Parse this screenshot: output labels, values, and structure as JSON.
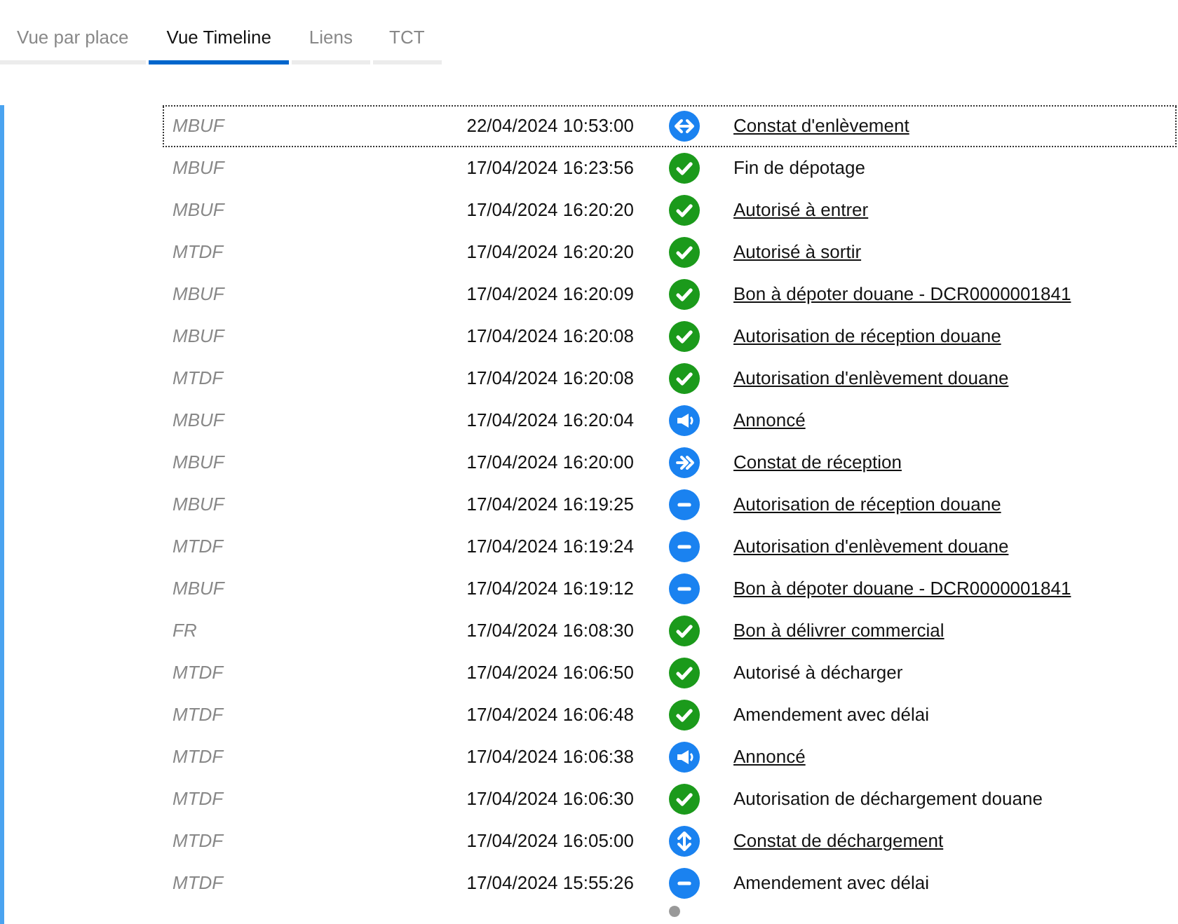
{
  "tabs": [
    {
      "label": "Vue par place",
      "selected": false
    },
    {
      "label": "Vue Timeline",
      "selected": true
    },
    {
      "label": "Liens",
      "selected": false
    },
    {
      "label": "TCT",
      "selected": false
    }
  ],
  "events": [
    {
      "source": "MBUF",
      "date": "22/04/2024 10:53:00",
      "kind": "exchange",
      "label": "Constat d'enlèvement",
      "link": true,
      "focused": true
    },
    {
      "source": "MBUF",
      "date": "17/04/2024 16:23:56",
      "kind": "check",
      "label": "Fin de dépotage",
      "link": false,
      "focused": false
    },
    {
      "source": "MBUF",
      "date": "17/04/2024 16:20:20",
      "kind": "check",
      "label": "Autorisé à entrer",
      "link": true,
      "focused": false
    },
    {
      "source": "MTDF",
      "date": "17/04/2024 16:20:20",
      "kind": "check",
      "label": "Autorisé à sortir",
      "link": true,
      "focused": false
    },
    {
      "source": "MBUF",
      "date": "17/04/2024 16:20:09",
      "kind": "check",
      "label": "Bon à dépoter douane - DCR0000001841",
      "link": true,
      "focused": false
    },
    {
      "source": "MBUF",
      "date": "17/04/2024 16:20:08",
      "kind": "check",
      "label": "Autorisation de réception douane",
      "link": true,
      "focused": false
    },
    {
      "source": "MTDF",
      "date": "17/04/2024 16:20:08",
      "kind": "check",
      "label": "Autorisation d'enlèvement douane",
      "link": true,
      "focused": false
    },
    {
      "source": "MBUF",
      "date": "17/04/2024 16:20:04",
      "kind": "megaphone",
      "label": "Annoncé",
      "link": true,
      "focused": false
    },
    {
      "source": "MBUF",
      "date": "17/04/2024 16:20:00",
      "kind": "arrow-in",
      "label": "Constat de réception",
      "link": true,
      "focused": false
    },
    {
      "source": "MBUF",
      "date": "17/04/2024 16:19:25",
      "kind": "minus",
      "label": "Autorisation de réception douane",
      "link": true,
      "focused": false
    },
    {
      "source": "MTDF",
      "date": "17/04/2024 16:19:24",
      "kind": "minus",
      "label": "Autorisation d'enlèvement douane",
      "link": true,
      "focused": false
    },
    {
      "source": "MBUF",
      "date": "17/04/2024 16:19:12",
      "kind": "minus",
      "label": "Bon à dépoter douane - DCR0000001841",
      "link": true,
      "focused": false
    },
    {
      "source": "FR",
      "date": "17/04/2024 16:08:30",
      "kind": "check",
      "label": "Bon à délivrer commercial",
      "link": true,
      "focused": false
    },
    {
      "source": "MTDF",
      "date": "17/04/2024 16:06:50",
      "kind": "check",
      "label": "Autorisé à décharger",
      "link": false,
      "focused": false
    },
    {
      "source": "MTDF",
      "date": "17/04/2024 16:06:48",
      "kind": "check",
      "label": "Amendement avec délai",
      "link": false,
      "focused": false
    },
    {
      "source": "MTDF",
      "date": "17/04/2024 16:06:38",
      "kind": "megaphone",
      "label": "Annoncé",
      "link": true,
      "focused": false
    },
    {
      "source": "MTDF",
      "date": "17/04/2024 16:06:30",
      "kind": "check",
      "label": "Autorisation de déchargement douane",
      "link": false,
      "focused": false
    },
    {
      "source": "MTDF",
      "date": "17/04/2024 16:05:00",
      "kind": "updown",
      "label": "Constat de déchargement",
      "link": true,
      "focused": false
    },
    {
      "source": "MTDF",
      "date": "17/04/2024 15:55:26",
      "kind": "minus",
      "label": "Amendement avec délai",
      "link": false,
      "focused": false
    }
  ]
}
